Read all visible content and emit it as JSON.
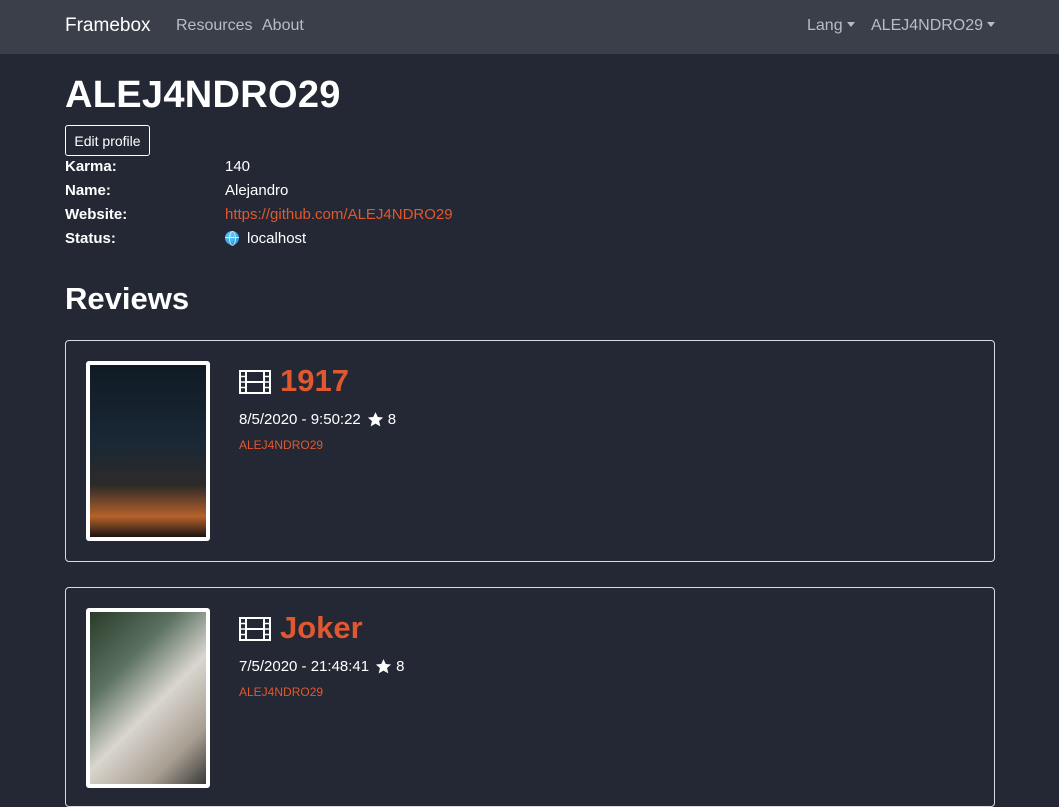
{
  "navbar": {
    "brand": "Framebox",
    "links": [
      "Resources",
      "About"
    ],
    "lang_label": "Lang",
    "user_label": "ALEJ4NDRO29"
  },
  "profile": {
    "username": "ALEJ4NDRO29",
    "edit_label": "Edit profile",
    "karma_label": "Karma:",
    "karma_value": "140",
    "name_label": "Name:",
    "name_value": "Alejandro",
    "website_label": "Website:",
    "website_value": "https://github.com/ALEJ4NDRO29",
    "status_label": "Status:",
    "status_value": "localhost",
    "status_icon": "globe-icon"
  },
  "reviews": {
    "title": "Reviews",
    "items": [
      {
        "movie": "1917",
        "datetime": "8/5/2020 - 9:50:22",
        "rating": "8",
        "author": "ALEJ4NDRO29"
      },
      {
        "movie": "Joker",
        "datetime": "7/5/2020 - 21:48:41",
        "rating": "8",
        "author": "ALEJ4NDRO29"
      }
    ]
  },
  "colors": {
    "background": "#232834",
    "navbar": "#3b3f4a",
    "accent": "#e0582f"
  }
}
